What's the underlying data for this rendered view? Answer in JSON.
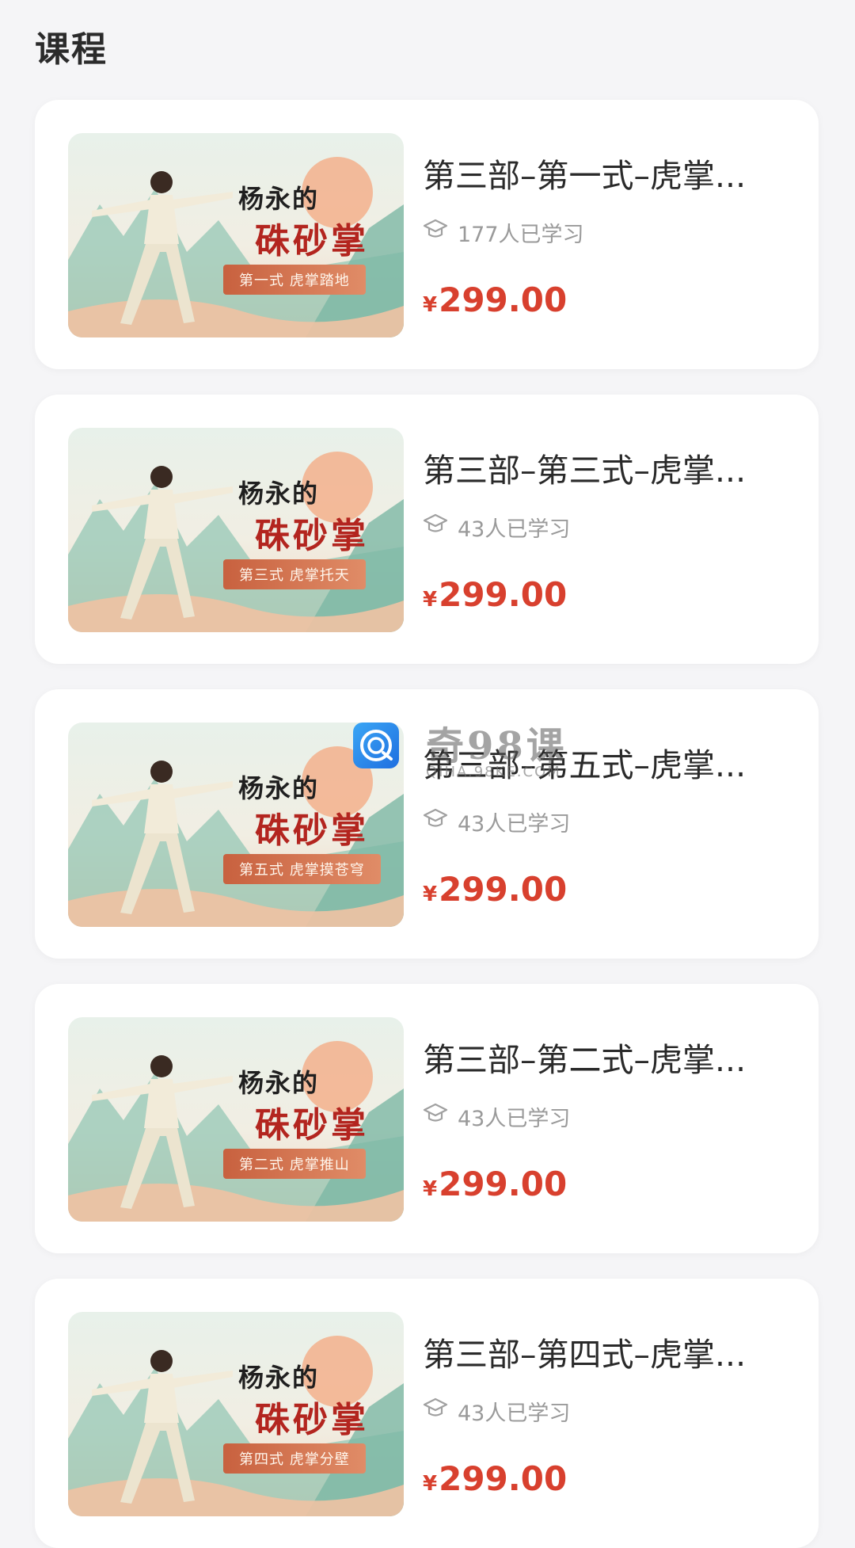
{
  "page": {
    "title": "课程"
  },
  "thumbnail": {
    "brand": "杨永的",
    "name": "硃砂掌"
  },
  "courses": [
    {
      "title": "第三部–第一式–虎掌...",
      "thumb_subtitle": "第一式 虎掌踏地",
      "learners": "177人已学习",
      "currency": "¥",
      "price": "299.00"
    },
    {
      "title": "第三部–第三式–虎掌...",
      "thumb_subtitle": "第三式 虎掌托天",
      "learners": "43人已学习",
      "currency": "¥",
      "price": "299.00"
    },
    {
      "title": "第三部–第五式–虎掌...",
      "thumb_subtitle": "第五式 虎掌摸苍穹",
      "learners": "43人已学习",
      "currency": "¥",
      "price": "299.00"
    },
    {
      "title": "第三部–第二式–虎掌...",
      "thumb_subtitle": "第二式 虎掌推山",
      "learners": "43人已学习",
      "currency": "¥",
      "price": "299.00"
    },
    {
      "title": "第三部–第四式–虎掌...",
      "thumb_subtitle": "第四式 虎掌分壁",
      "learners": "43人已学习",
      "currency": "¥",
      "price": "299.00"
    }
  ],
  "watermark": {
    "text": "奇98课",
    "url": "QIHA.98KE.COM"
  },
  "colors": {
    "price": "#d8402e",
    "muted": "#9a9a9a",
    "card": "#ffffff",
    "background": "#f5f5f7"
  },
  "icons": {
    "learners": "graduation-cap-icon"
  }
}
